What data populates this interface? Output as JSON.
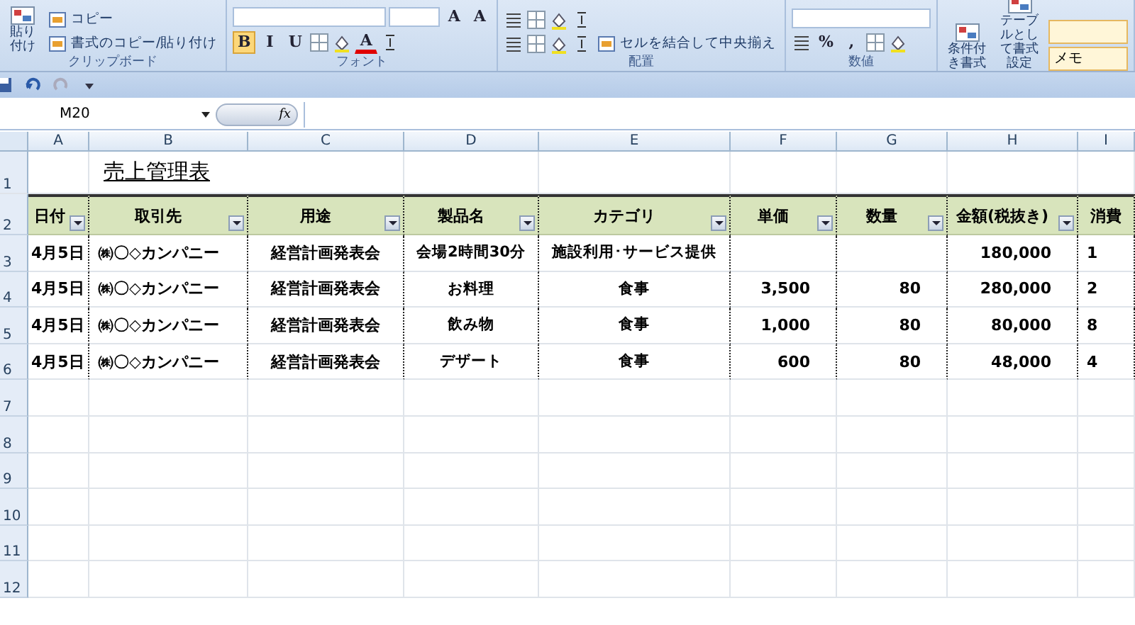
{
  "ribbon": {
    "groups": [
      {
        "label": "クリップボード",
        "columns": [
          [
            [
              {
                "kind": "big",
                "label": "貼り付け"
              }
            ]
          ],
          [
            [
              {
                "kind": "small",
                "label": "コピー"
              }
            ],
            [
              {
                "kind": "small",
                "label": "書式のコピー/貼り付け"
              }
            ]
          ]
        ]
      },
      {
        "label": "フォント",
        "columns": [
          [
            [
              {
                "kind": "field"
              },
              {
                "kind": "field"
              },
              {
                "kind": "glyph",
                "label": "A"
              },
              {
                "kind": "glyph",
                "label": "A"
              }
            ],
            [
              {
                "kind": "glyph",
                "label": "B",
                "selected": true
              },
              {
                "kind": "glyph",
                "label": "I",
                "selected": false
              },
              {
                "kind": "glyph",
                "label": "U",
                "selected": false
              },
              {
                "kind": "icon"
              },
              {
                "kind": "icon"
              },
              {
                "kind": "glyph",
                "label": "A",
                "selected": false,
                "color": "#e00000"
              },
              {
                "kind": "icon"
              }
            ]
          ]
        ]
      },
      {
        "label": "配置",
        "columns": [
          [
            [
              {
                "kind": "icon"
              },
              {
                "kind": "icon"
              },
              {
                "kind": "icon"
              },
              {
                "kind": "icon"
              }
            ],
            [
              {
                "kind": "icon"
              },
              {
                "kind": "icon"
              },
              {
                "kind": "icon"
              },
              {
                "kind": "icon"
              },
              {
                "kind": "small",
                "label": "セルを結合して中央揃え"
              }
            ]
          ]
        ]
      },
      {
        "label": "数値",
        "columns": [
          [
            [
              {
                "kind": "field"
              }
            ],
            [
              {
                "kind": "icon"
              },
              {
                "kind": "glyph",
                "label": "%",
                "selected": false
              },
              {
                "kind": "glyph",
                "label": ",",
                "selected": false
              },
              {
                "kind": "icon"
              },
              {
                "kind": "icon"
              }
            ]
          ]
        ]
      },
      {
        "columns": [
          [
            [
              {
                "kind": "big",
                "label": "条件付き書式"
              }
            ]
          ],
          [
            [
              {
                "kind": "big",
                "label": "テーブルとして書式設定"
              }
            ]
          ],
          [
            [
              {
                "kind": "stylebox"
              }
            ],
            [
              {
                "kind": "stylebox",
                "value": "メモ"
              }
            ]
          ]
        ]
      }
    ]
  },
  "formula_bar": {
    "name_box": "M20",
    "fx": "fx"
  },
  "sheet": {
    "columns": [
      "A",
      "B",
      "C",
      "D",
      "E",
      "F",
      "G",
      "H",
      "I"
    ],
    "title": "売上管理表",
    "header": [
      {
        "text": "日付",
        "filter": true
      },
      {
        "text": "取引先",
        "filter": true
      },
      {
        "text": "用途",
        "filter": true
      },
      {
        "text": "製品名",
        "filter": true
      },
      {
        "text": "カテゴリ",
        "filter": true
      },
      {
        "text": "単価",
        "filter": true
      },
      {
        "text": "数量",
        "filter": true
      },
      {
        "text": "金額(税抜き)",
        "filter": true
      },
      {
        "text": "消費",
        "filter": false
      }
    ],
    "rows": [
      [
        "4月5日",
        "㈱〇◇カンパニー",
        "経営計画発表会",
        "会場2時間30分",
        "施設利用･サービス提供",
        "",
        "",
        "180,000",
        "1"
      ],
      [
        "4月5日",
        "㈱〇◇カンパニー",
        "経営計画発表会",
        "お料理",
        "食事",
        "3,500",
        "80",
        "280,000",
        "2"
      ],
      [
        "4月5日",
        "㈱〇◇カンパニー",
        "経営計画発表会",
        "飲み物",
        "食事",
        "1,000",
        "80",
        "80,000",
        "8"
      ],
      [
        "4月5日",
        "㈱〇◇カンパニー",
        "経営計画発表会",
        "デザート",
        "食事",
        "600",
        "80",
        "48,000",
        "4"
      ]
    ],
    "row_numbers": [
      "1",
      "2",
      "3",
      "4",
      "5",
      "6",
      "7",
      "8",
      "9",
      "10",
      "11",
      "12"
    ]
  }
}
